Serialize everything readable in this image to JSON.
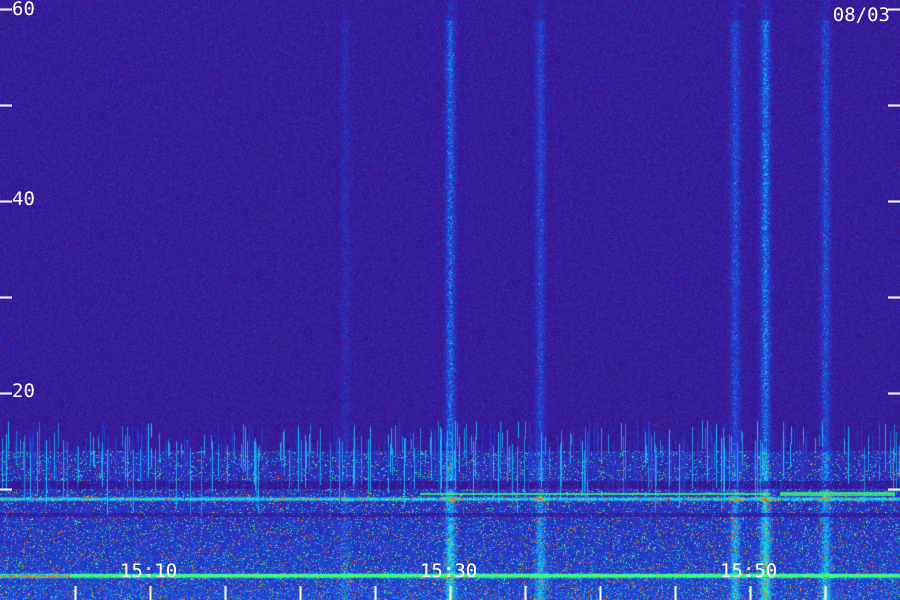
{
  "date_label": "08/03",
  "chart_data": {
    "type": "heatmap",
    "title": "",
    "xlabel": "",
    "ylabel": "",
    "ylim": [
      0,
      60
    ],
    "y_ticks": [
      0,
      10,
      20,
      30,
      40,
      50,
      60
    ],
    "y_tick_labels": [
      {
        "value": 60,
        "label": "60"
      },
      {
        "value": 40,
        "label": "40"
      },
      {
        "value": 20,
        "label": "20"
      }
    ],
    "x_time_range": [
      "15:02",
      "15:58"
    ],
    "x_major_ticks": [
      "15:05",
      "15:10",
      "15:15",
      "15:20",
      "15:25",
      "15:30",
      "15:35",
      "15:40",
      "15:45",
      "15:50",
      "15:55"
    ],
    "x_tick_labels": [
      {
        "time": "15:10",
        "label": "15:10"
      },
      {
        "time": "15:30",
        "label": "15:30"
      },
      {
        "time": "15:50",
        "label": "15:50"
      }
    ],
    "vertical_bands": [
      {
        "time": "15:23",
        "intensity": 0.25
      },
      {
        "time": "15:30",
        "intensity": 0.75
      },
      {
        "time": "15:36",
        "intensity": 0.55
      },
      {
        "time": "15:49",
        "intensity": 0.6
      },
      {
        "time": "15:51",
        "intensity": 0.85
      },
      {
        "time": "15:55",
        "intensity": 0.6
      }
    ],
    "horizontal_lines": [
      {
        "y": 1,
        "intensity": 0.9
      },
      {
        "y": 9,
        "intensity": 0.7
      }
    ],
    "colors": {
      "background": "#2a0d6e",
      "noise": "#3a1a9a",
      "low": "#1e46d8",
      "mid": "#14c8ff",
      "high": "#3cff78",
      "peak": "#ff5a1e"
    }
  }
}
